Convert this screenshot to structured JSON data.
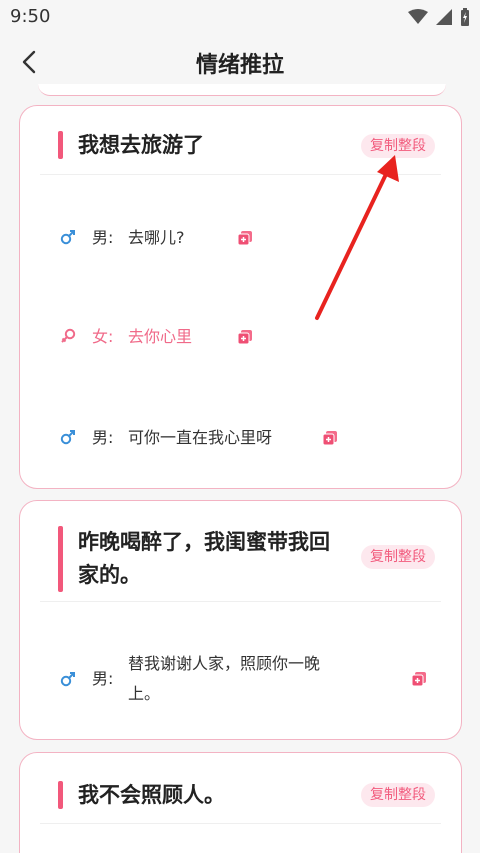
{
  "status": {
    "time": "9:50"
  },
  "header": {
    "title": "情绪推拉"
  },
  "cards": [
    {
      "title": "我想去旅游了",
      "copy_label": "复制整段",
      "lines": [
        {
          "gender": "male",
          "speaker": "男:",
          "text": "去哪儿?"
        },
        {
          "gender": "female",
          "speaker": "女:",
          "text": "去你心里"
        },
        {
          "gender": "male",
          "speaker": "男:",
          "text": "可你一直在我心里呀"
        }
      ]
    },
    {
      "title_line1": "昨晚喝醉了，我闺蜜带我回",
      "title_line2": "家的。",
      "copy_label": "复制整段",
      "lines": [
        {
          "gender": "male",
          "speaker": "男:",
          "text_line1": "替我谢谢人家，照顾你一晚",
          "text_line2": "上。"
        }
      ]
    },
    {
      "title": "我不会照顾人。",
      "copy_label": "复制整段"
    }
  ],
  "colors": {
    "accent": "#f2587b",
    "male": "#3a8fd8",
    "female": "#f06a89",
    "border": "#f3b3c3",
    "annotation": "#e8231f"
  }
}
